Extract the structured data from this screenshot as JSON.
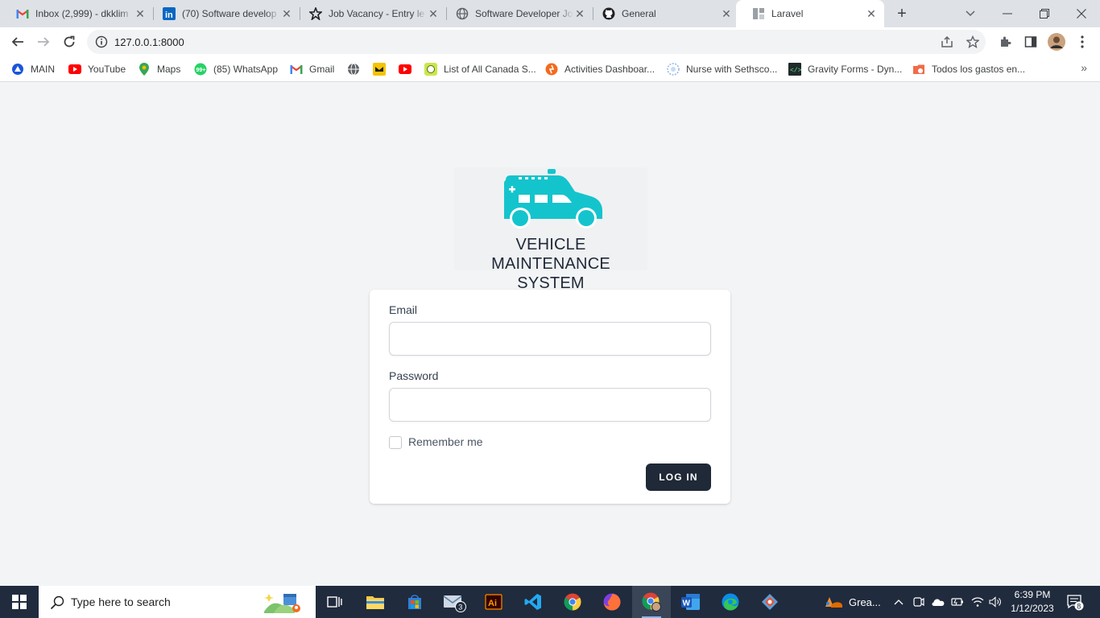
{
  "browser": {
    "tabs": [
      {
        "label": "Inbox (2,999) - dkklim",
        "icon": "gmail-icon"
      },
      {
        "label": "(70) Software develop",
        "icon": "linkedin-icon"
      },
      {
        "label": "Job Vacancy - Entry le",
        "icon": "job-icon"
      },
      {
        "label": "Software Developer Jo",
        "icon": "globe-icon"
      },
      {
        "label": "General",
        "icon": "github-icon"
      },
      {
        "label": "Laravel",
        "icon": "laravel-page-icon",
        "active": true
      }
    ],
    "new_tab_symbol": "+",
    "url": "127.0.0.1:8000"
  },
  "bookmarks": [
    {
      "label": "MAIN",
      "icon": "main-icon"
    },
    {
      "label": "YouTube",
      "icon": "youtube-icon"
    },
    {
      "label": "Maps",
      "icon": "maps-icon"
    },
    {
      "label": "(85) WhatsApp",
      "icon": "whatsapp-icon"
    },
    {
      "label": "Gmail",
      "icon": "gmail-icon"
    },
    {
      "label": "",
      "icon": "globe-icon"
    },
    {
      "label": "",
      "icon": "yellow-app-icon"
    },
    {
      "label": "",
      "icon": "youtube-icon"
    },
    {
      "label": "List of All Canada S...",
      "icon": "list-icon"
    },
    {
      "label": "Activities Dashboar...",
      "icon": "activities-icon"
    },
    {
      "label": "Nurse with Sethsco...",
      "icon": "nurse-icon"
    },
    {
      "label": "Gravity Forms - Dyn...",
      "icon": "code-icon"
    },
    {
      "label": "Todos los gastos en...",
      "icon": "gastos-icon"
    }
  ],
  "bookmarks_more": "»",
  "app": {
    "title_line1": "VEHICLE MAINTENANCE",
    "title_line2": "SYSTEM",
    "brand_color": "#14c4cc"
  },
  "login": {
    "email_label": "Email",
    "email_value": "",
    "password_label": "Password",
    "password_value": "",
    "remember_label": "Remember me",
    "submit_label": "LOG IN"
  },
  "taskbar": {
    "search_placeholder": "Type here to search",
    "mail_badge": "3",
    "tray_weather": "Grea...",
    "time": "6:39 PM",
    "date": "1/12/2023",
    "notification_count": "8"
  }
}
